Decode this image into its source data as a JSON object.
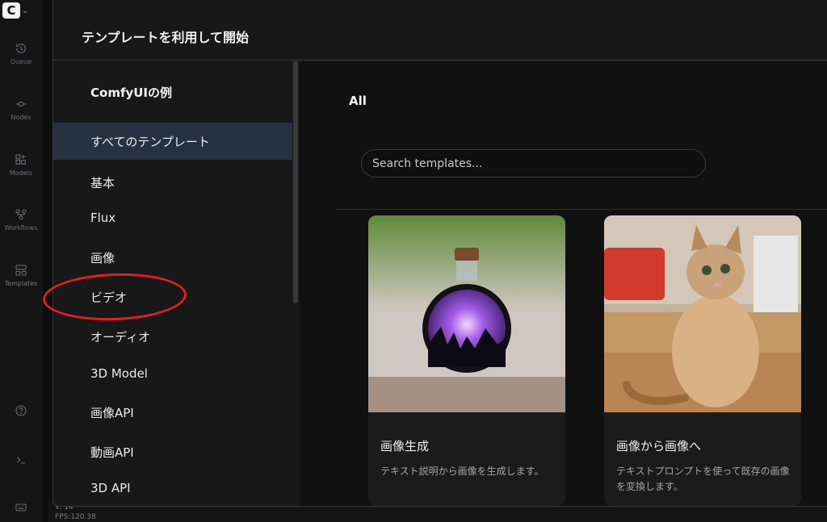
{
  "app": {
    "logo_letter": "C",
    "rail": [
      {
        "label": "Queue",
        "icon": "history-icon"
      },
      {
        "label": "Nodes",
        "icon": "nodes-icon"
      },
      {
        "label": "Models",
        "icon": "models-icon"
      },
      {
        "label": "Workflows",
        "icon": "workflows-icon"
      },
      {
        "label": "Templates",
        "icon": "templates-icon"
      }
    ],
    "status": {
      "version": "V: 14",
      "fps": "FPS:120.38"
    }
  },
  "dialog": {
    "title": "テンプレートを利用して開始",
    "sidebar_title": "ComfyUIの例",
    "nav": [
      "すべてのテンプレート",
      "基本",
      "Flux",
      "画像",
      "ビデオ",
      "オーディオ",
      "3D Model",
      "画像API",
      "動画API",
      "3D API"
    ],
    "active_nav": "すべてのテンプレート",
    "section_title": "All",
    "search": {
      "placeholder": "Search templates..."
    },
    "cards": [
      {
        "title": "画像生成",
        "description": "テキスト説明から画像を生成します。"
      },
      {
        "title": "画像から画像へ",
        "description": "テキストプロンプトを使って既存の画像を変換します。"
      }
    ]
  },
  "colors": {
    "active_nav_bg": "#263244",
    "annotation_circle": "#e02020"
  }
}
